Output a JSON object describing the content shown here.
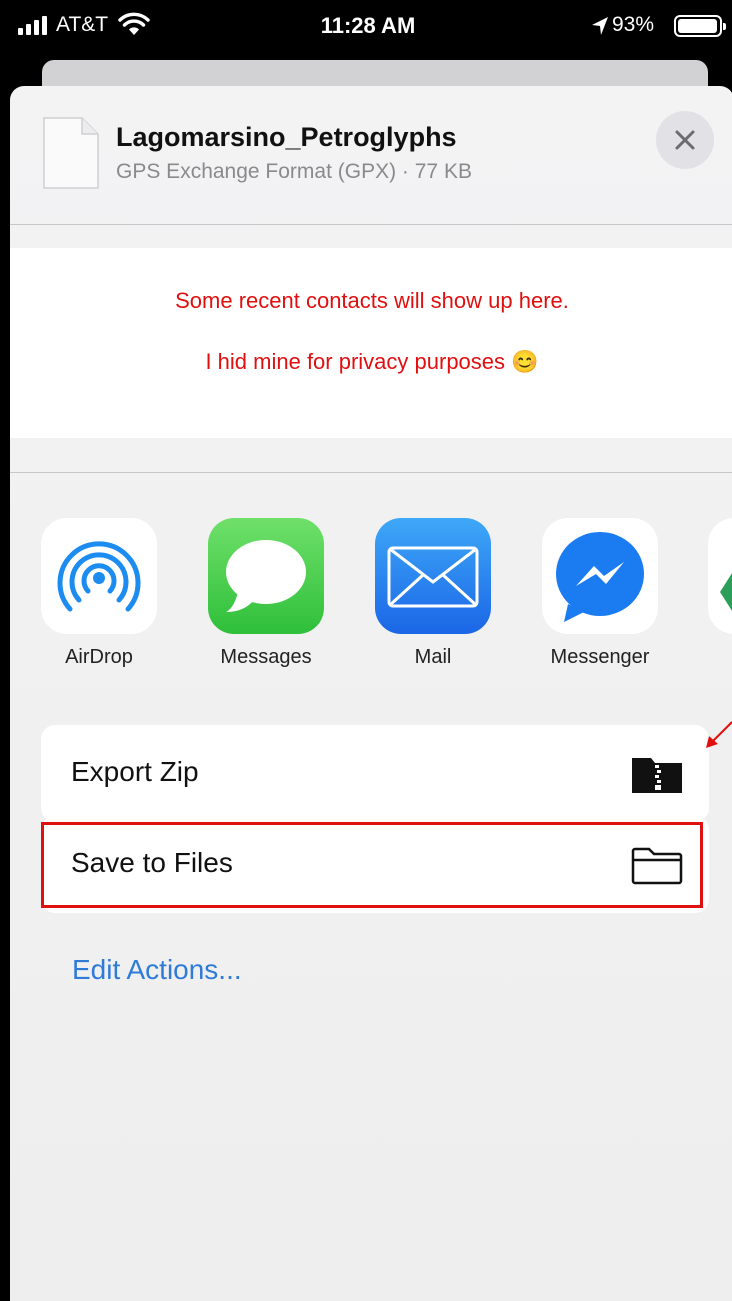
{
  "status_bar": {
    "carrier": "AT&T",
    "time": "11:28 AM",
    "battery_percent": "93%",
    "icons": [
      "signal-bars-icon",
      "wifi-icon",
      "location-arrow-icon",
      "battery-icon"
    ]
  },
  "share_sheet": {
    "file": {
      "name": "Lagomarsino_Petroglyphs",
      "meta": "GPS Exchange Format (GPX) · 77 KB",
      "icon": "document-icon"
    },
    "close_icon": "close-icon",
    "privacy_note": {
      "line1": "Some recent contacts will show up here.",
      "line2": "I hid mine for privacy purposes 😊",
      "color": "#e01010"
    },
    "apps": [
      {
        "label": "AirDrop",
        "icon": "airdrop-icon"
      },
      {
        "label": "Messages",
        "icon": "messages-icon"
      },
      {
        "label": "Mail",
        "icon": "mail-icon"
      },
      {
        "label": "Messenger",
        "icon": "messenger-icon"
      }
    ],
    "actions": [
      {
        "label": "Export Zip",
        "icon": "zip-folder-icon"
      },
      {
        "label": "Save to Files",
        "icon": "folder-icon",
        "highlighted": true
      }
    ],
    "edit_actions": "Edit Actions...",
    "accent_color": "#2f7bd8"
  }
}
